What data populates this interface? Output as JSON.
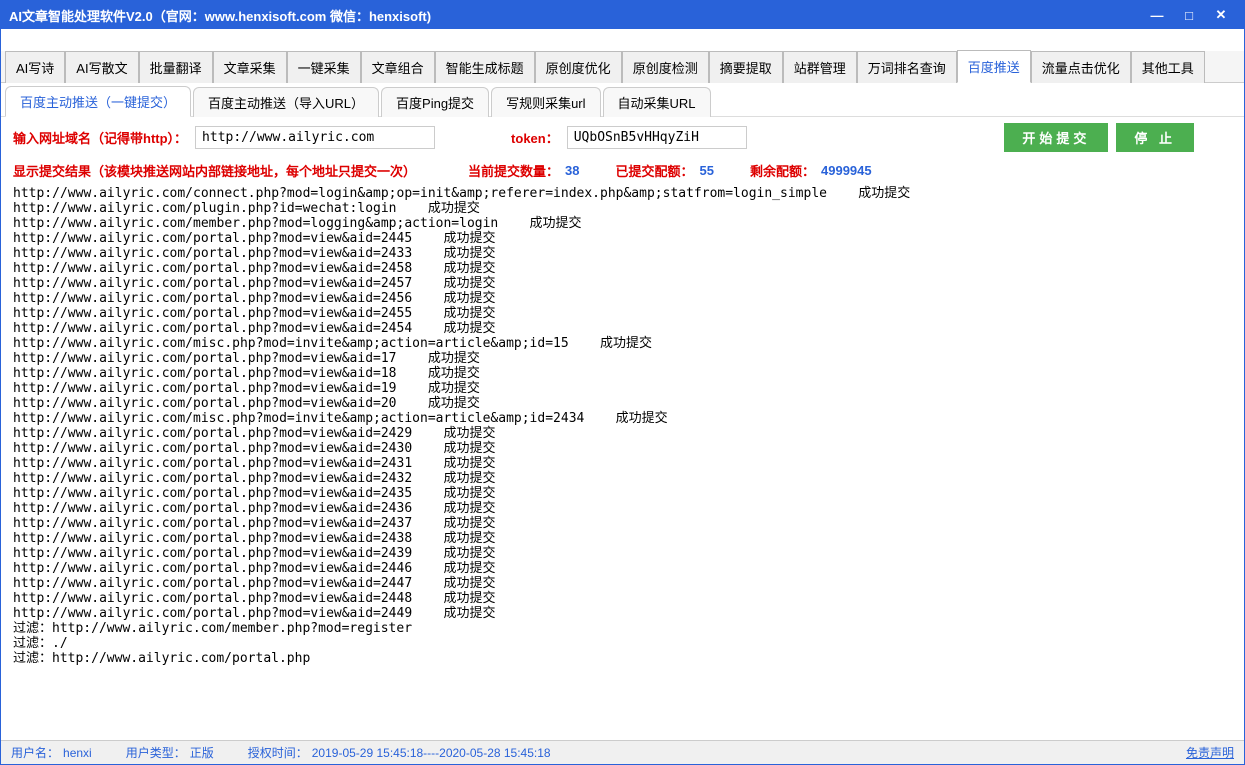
{
  "title": "AI文章智能处理软件V2.0（官网：www.henxisoft.com  微信：henxisoft)",
  "winbtns": {
    "min": "—",
    "max": "□",
    "close": "✕"
  },
  "main_tabs": [
    "AI写诗",
    "AI写散文",
    "批量翻译",
    "文章采集",
    "一键采集",
    "文章组合",
    "智能生成标题",
    "原创度优化",
    "原创度检测",
    "摘要提取",
    "站群管理",
    "万词排名查询",
    "百度推送",
    "流量点击优化",
    "其他工具"
  ],
  "main_tab_active": 12,
  "sub_tabs": [
    "百度主动推送（一键提交）",
    "百度主动推送（导入URL）",
    "百度Ping提交",
    "写规则采集url",
    "自动采集URL"
  ],
  "sub_tab_active": 0,
  "form": {
    "domain_label": "输入网址域名（记得带http）：",
    "domain_value": "http://www.ailyric.com",
    "token_label": "token：",
    "token_value": "UQbOSnB5vHHqyZiH",
    "start_btn": "开始提交",
    "stop_btn": "停 止"
  },
  "stats": {
    "result_label": "显示提交结果（该模块推送网站内部链接地址，每个地址只提交一次）",
    "current_label": "当前提交数量：",
    "current_value": "38",
    "submitted_label": "已提交配额：",
    "submitted_value": "55",
    "remaining_label": "剩余配额：",
    "remaining_value": "4999945"
  },
  "log_lines": [
    "http://www.ailyric.com/connect.php?mod=login&amp;op=init&amp;referer=index.php&amp;statfrom=login_simple    成功提交",
    "http://www.ailyric.com/plugin.php?id=wechat:login    成功提交",
    "http://www.ailyric.com/member.php?mod=logging&amp;action=login    成功提交",
    "http://www.ailyric.com/portal.php?mod=view&aid=2445    成功提交",
    "http://www.ailyric.com/portal.php?mod=view&aid=2433    成功提交",
    "http://www.ailyric.com/portal.php?mod=view&aid=2458    成功提交",
    "http://www.ailyric.com/portal.php?mod=view&aid=2457    成功提交",
    "http://www.ailyric.com/portal.php?mod=view&aid=2456    成功提交",
    "http://www.ailyric.com/portal.php?mod=view&aid=2455    成功提交",
    "http://www.ailyric.com/portal.php?mod=view&aid=2454    成功提交",
    "http://www.ailyric.com/misc.php?mod=invite&amp;action=article&amp;id=15    成功提交",
    "http://www.ailyric.com/portal.php?mod=view&aid=17    成功提交",
    "http://www.ailyric.com/portal.php?mod=view&aid=18    成功提交",
    "http://www.ailyric.com/portal.php?mod=view&aid=19    成功提交",
    "http://www.ailyric.com/portal.php?mod=view&aid=20    成功提交",
    "http://www.ailyric.com/misc.php?mod=invite&amp;action=article&amp;id=2434    成功提交",
    "http://www.ailyric.com/portal.php?mod=view&aid=2429    成功提交",
    "http://www.ailyric.com/portal.php?mod=view&aid=2430    成功提交",
    "http://www.ailyric.com/portal.php?mod=view&aid=2431    成功提交",
    "http://www.ailyric.com/portal.php?mod=view&aid=2432    成功提交",
    "http://www.ailyric.com/portal.php?mod=view&aid=2435    成功提交",
    "http://www.ailyric.com/portal.php?mod=view&aid=2436    成功提交",
    "http://www.ailyric.com/portal.php?mod=view&aid=2437    成功提交",
    "http://www.ailyric.com/portal.php?mod=view&aid=2438    成功提交",
    "http://www.ailyric.com/portal.php?mod=view&aid=2439    成功提交",
    "http://www.ailyric.com/portal.php?mod=view&aid=2446    成功提交",
    "http://www.ailyric.com/portal.php?mod=view&aid=2447    成功提交",
    "http://www.ailyric.com/portal.php?mod=view&aid=2448    成功提交",
    "http://www.ailyric.com/portal.php?mod=view&aid=2449    成功提交",
    "",
    "过滤：http://www.ailyric.com/member.php?mod=register",
    "过滤：./",
    "过滤：http://www.ailyric.com/portal.php"
  ],
  "status": {
    "user_label": "用户名：",
    "user_value": "henxi",
    "type_label": "用户类型：",
    "type_value": "正版",
    "auth_label": "授权时间：",
    "auth_value": "2019-05-29 15:45:18----2020-05-28 15:45:18",
    "disclaimer": "免责声明"
  }
}
